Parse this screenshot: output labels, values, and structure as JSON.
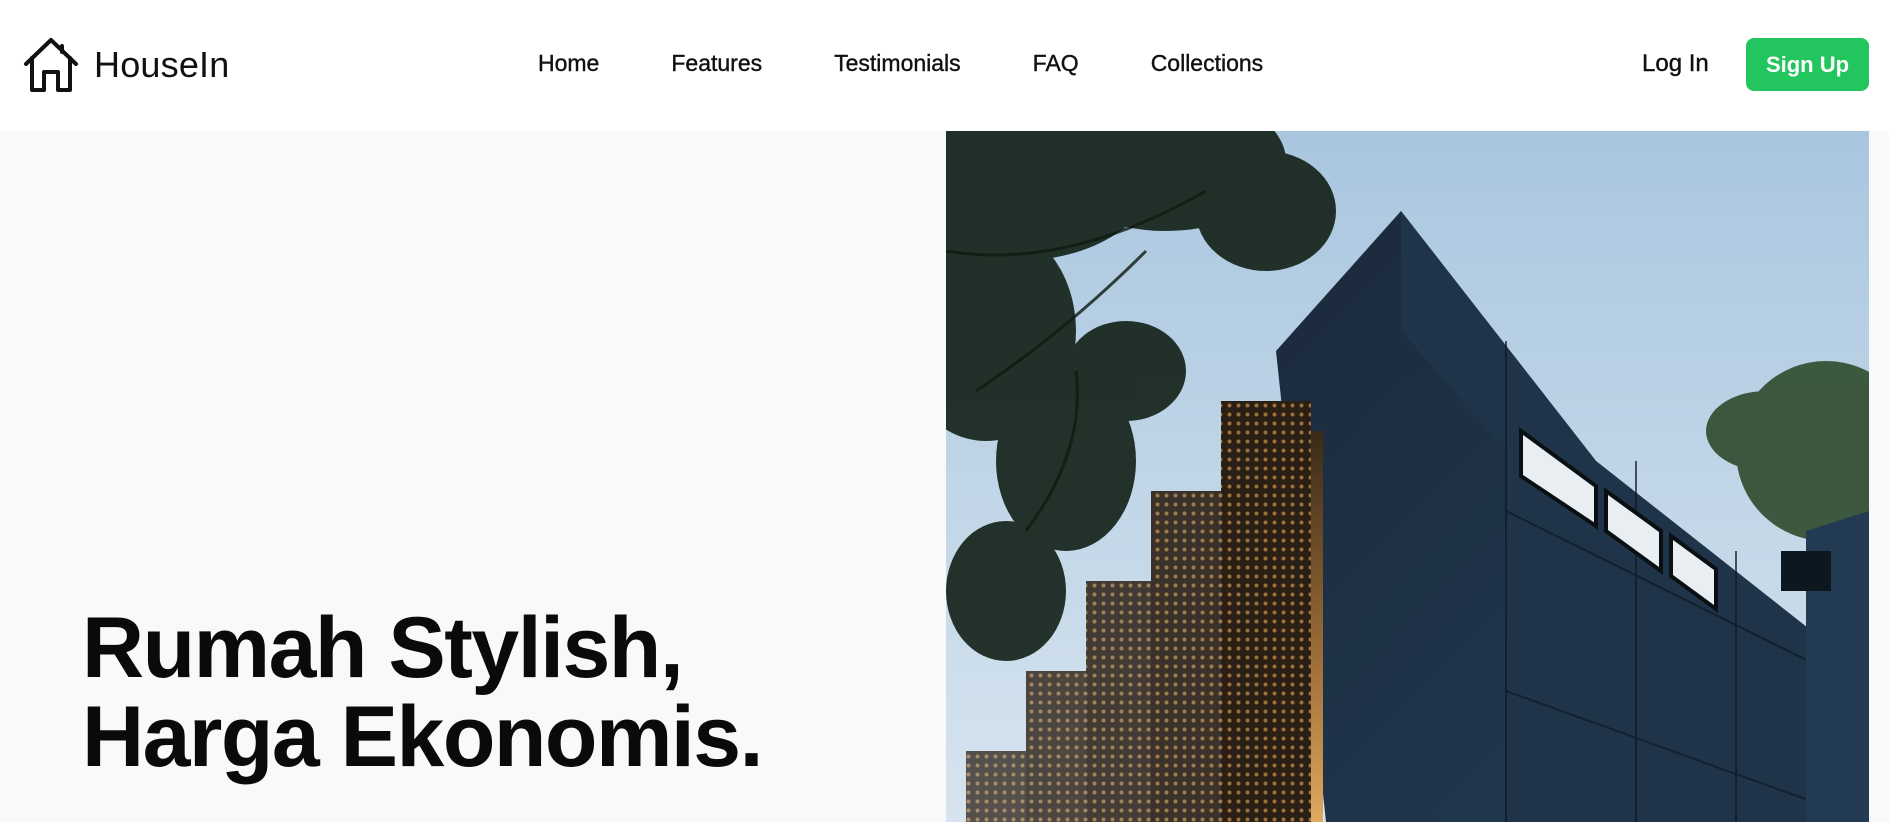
{
  "brand": {
    "name": "HouseIn",
    "icon": "house-icon"
  },
  "nav": {
    "links": [
      "Home",
      "Features",
      "Testimonials",
      "FAQ",
      "Collections"
    ]
  },
  "auth": {
    "login_label": "Log In",
    "signup_label": "Sign Up"
  },
  "hero": {
    "title_line1": "Rumah Stylish,",
    "title_line2": "Harga Ekonomis.",
    "image": "modern-dark-house-photo"
  },
  "colors": {
    "accent": "#22c55e",
    "hero_background": "#f8f9fb",
    "text": "#0a0a0a"
  }
}
